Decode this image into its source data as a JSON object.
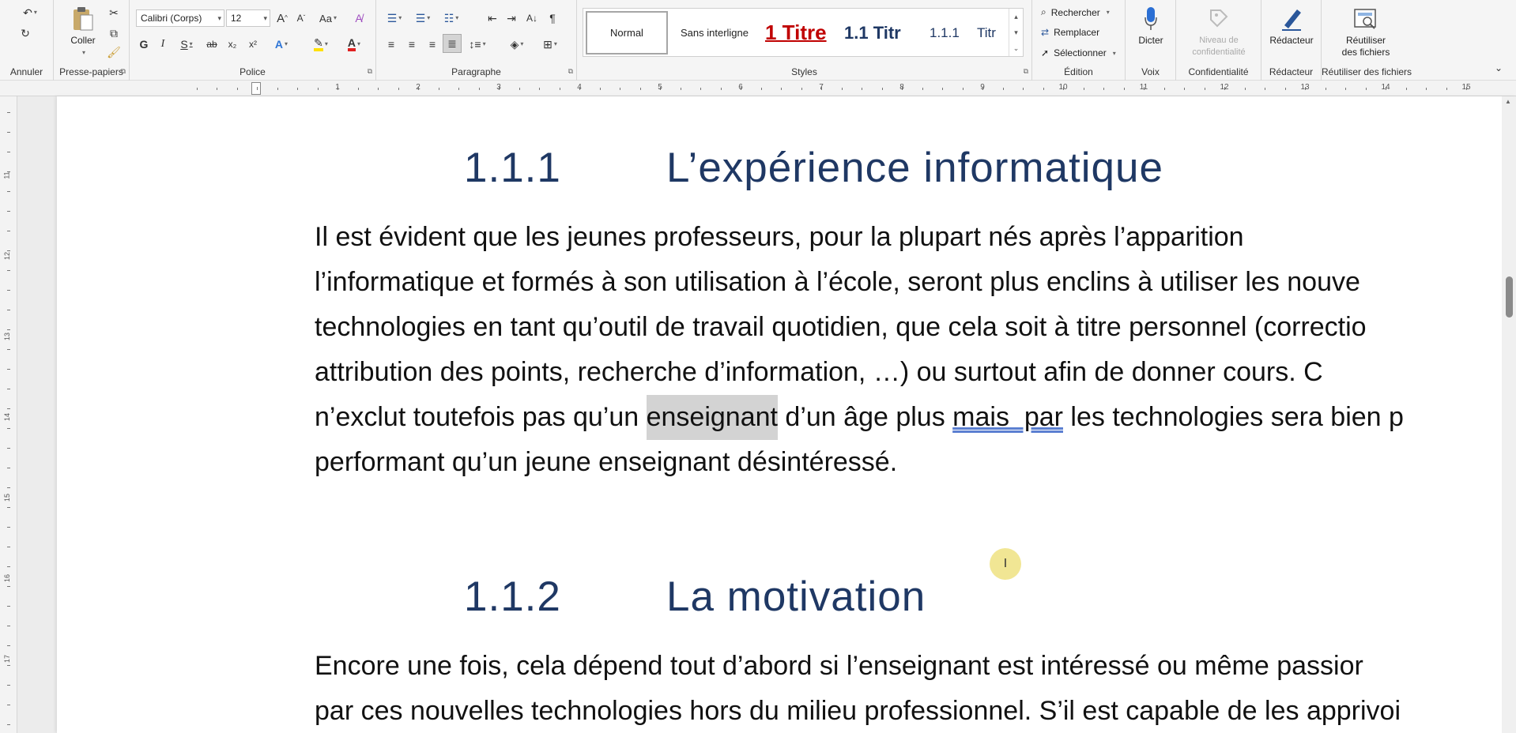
{
  "ribbon": {
    "undo_group": {
      "label": "Annuler"
    },
    "clipboard": {
      "label": "Presse-papiers",
      "paste_label": "Coller"
    },
    "font": {
      "label": "Police",
      "font_name": "Calibri (Corps)",
      "font_size": "12",
      "bold": "G",
      "italic": "I",
      "underline": "S",
      "strike": "ab",
      "subscript": "x₂",
      "superscript": "x²",
      "case": "Aa",
      "grow": "A",
      "shrink": "A"
    },
    "paragraph": {
      "label": "Paragraphe"
    },
    "styles": {
      "label": "Styles",
      "items": [
        {
          "name": "Normal",
          "color": "#222222"
        },
        {
          "name": "Sans interligne",
          "color": "#222222"
        },
        {
          "name": "1  Titre",
          "color": "#c00000"
        },
        {
          "name": "1.1  Titr",
          "color": "#1f3864"
        },
        {
          "name": "1.1.1",
          "color": "#1f3864"
        },
        {
          "name": "Titr",
          "color": "#1f3864"
        }
      ]
    },
    "editing": {
      "label": "Édition",
      "find": "Rechercher",
      "replace": "Remplacer",
      "select": "Sélectionner"
    },
    "voice": {
      "label": "Voix",
      "dictate": "Dicter"
    },
    "confidentiality": {
      "label": "Confidentialité",
      "level_line1": "Niveau de",
      "level_line2": "confidentialité"
    },
    "editor": {
      "label": "Rédacteur",
      "button": "Rédacteur"
    },
    "reuse": {
      "label": "Réutiliser des fichiers",
      "button_line1": "Réutiliser",
      "button_line2": "des fichiers"
    }
  },
  "ruler": {
    "h_numbers": [
      "1",
      "2",
      "3",
      "4",
      "5",
      "6",
      "7",
      "8",
      "9",
      "10",
      "11",
      "12",
      "13",
      "14",
      "15"
    ],
    "v_numbers": [
      "11",
      "12",
      "13",
      "14",
      "15",
      "16",
      "17"
    ]
  },
  "document": {
    "heading1": {
      "number": "1.1.1",
      "text": "L’expérience informatique"
    },
    "para1": {
      "lines": [
        "Il est évident que les jeunes professeurs, pour la plupart nés après l’apparition",
        "l’informatique et formés à son utilisation à l’école, seront plus enclins à utiliser les nouve",
        "technologies en tant qu’outil de travail quotidien, que cela soit à titre personnel (correctio",
        "attribution des points, recherche d’information, …) ou surtout afin de donner cours. C"
      ],
      "line5_a": "n’exclut toutefois pas qu’un ",
      "line5_highlight": "enseignant",
      "line5_b": " d’un âge plus ",
      "line5_squiggle": "mais  par",
      "line5_c": " les technologies sera bien p",
      "line6": "performant qu’un jeune enseignant désintéressé."
    },
    "heading2": {
      "number": "1.1.2",
      "text": "La motivation"
    },
    "para2": {
      "lines": [
        "Encore une fois, cela dépend tout d’abord si l’enseignant est intéressé ou même passior",
        "par ces nouvelles technologies hors du milieu professionnel. S’il est capable de les apprivoi"
      ]
    }
  },
  "colors": {
    "heading": "#1f3864",
    "accent": "#2b579a",
    "highlight": "#d3d3d3"
  }
}
